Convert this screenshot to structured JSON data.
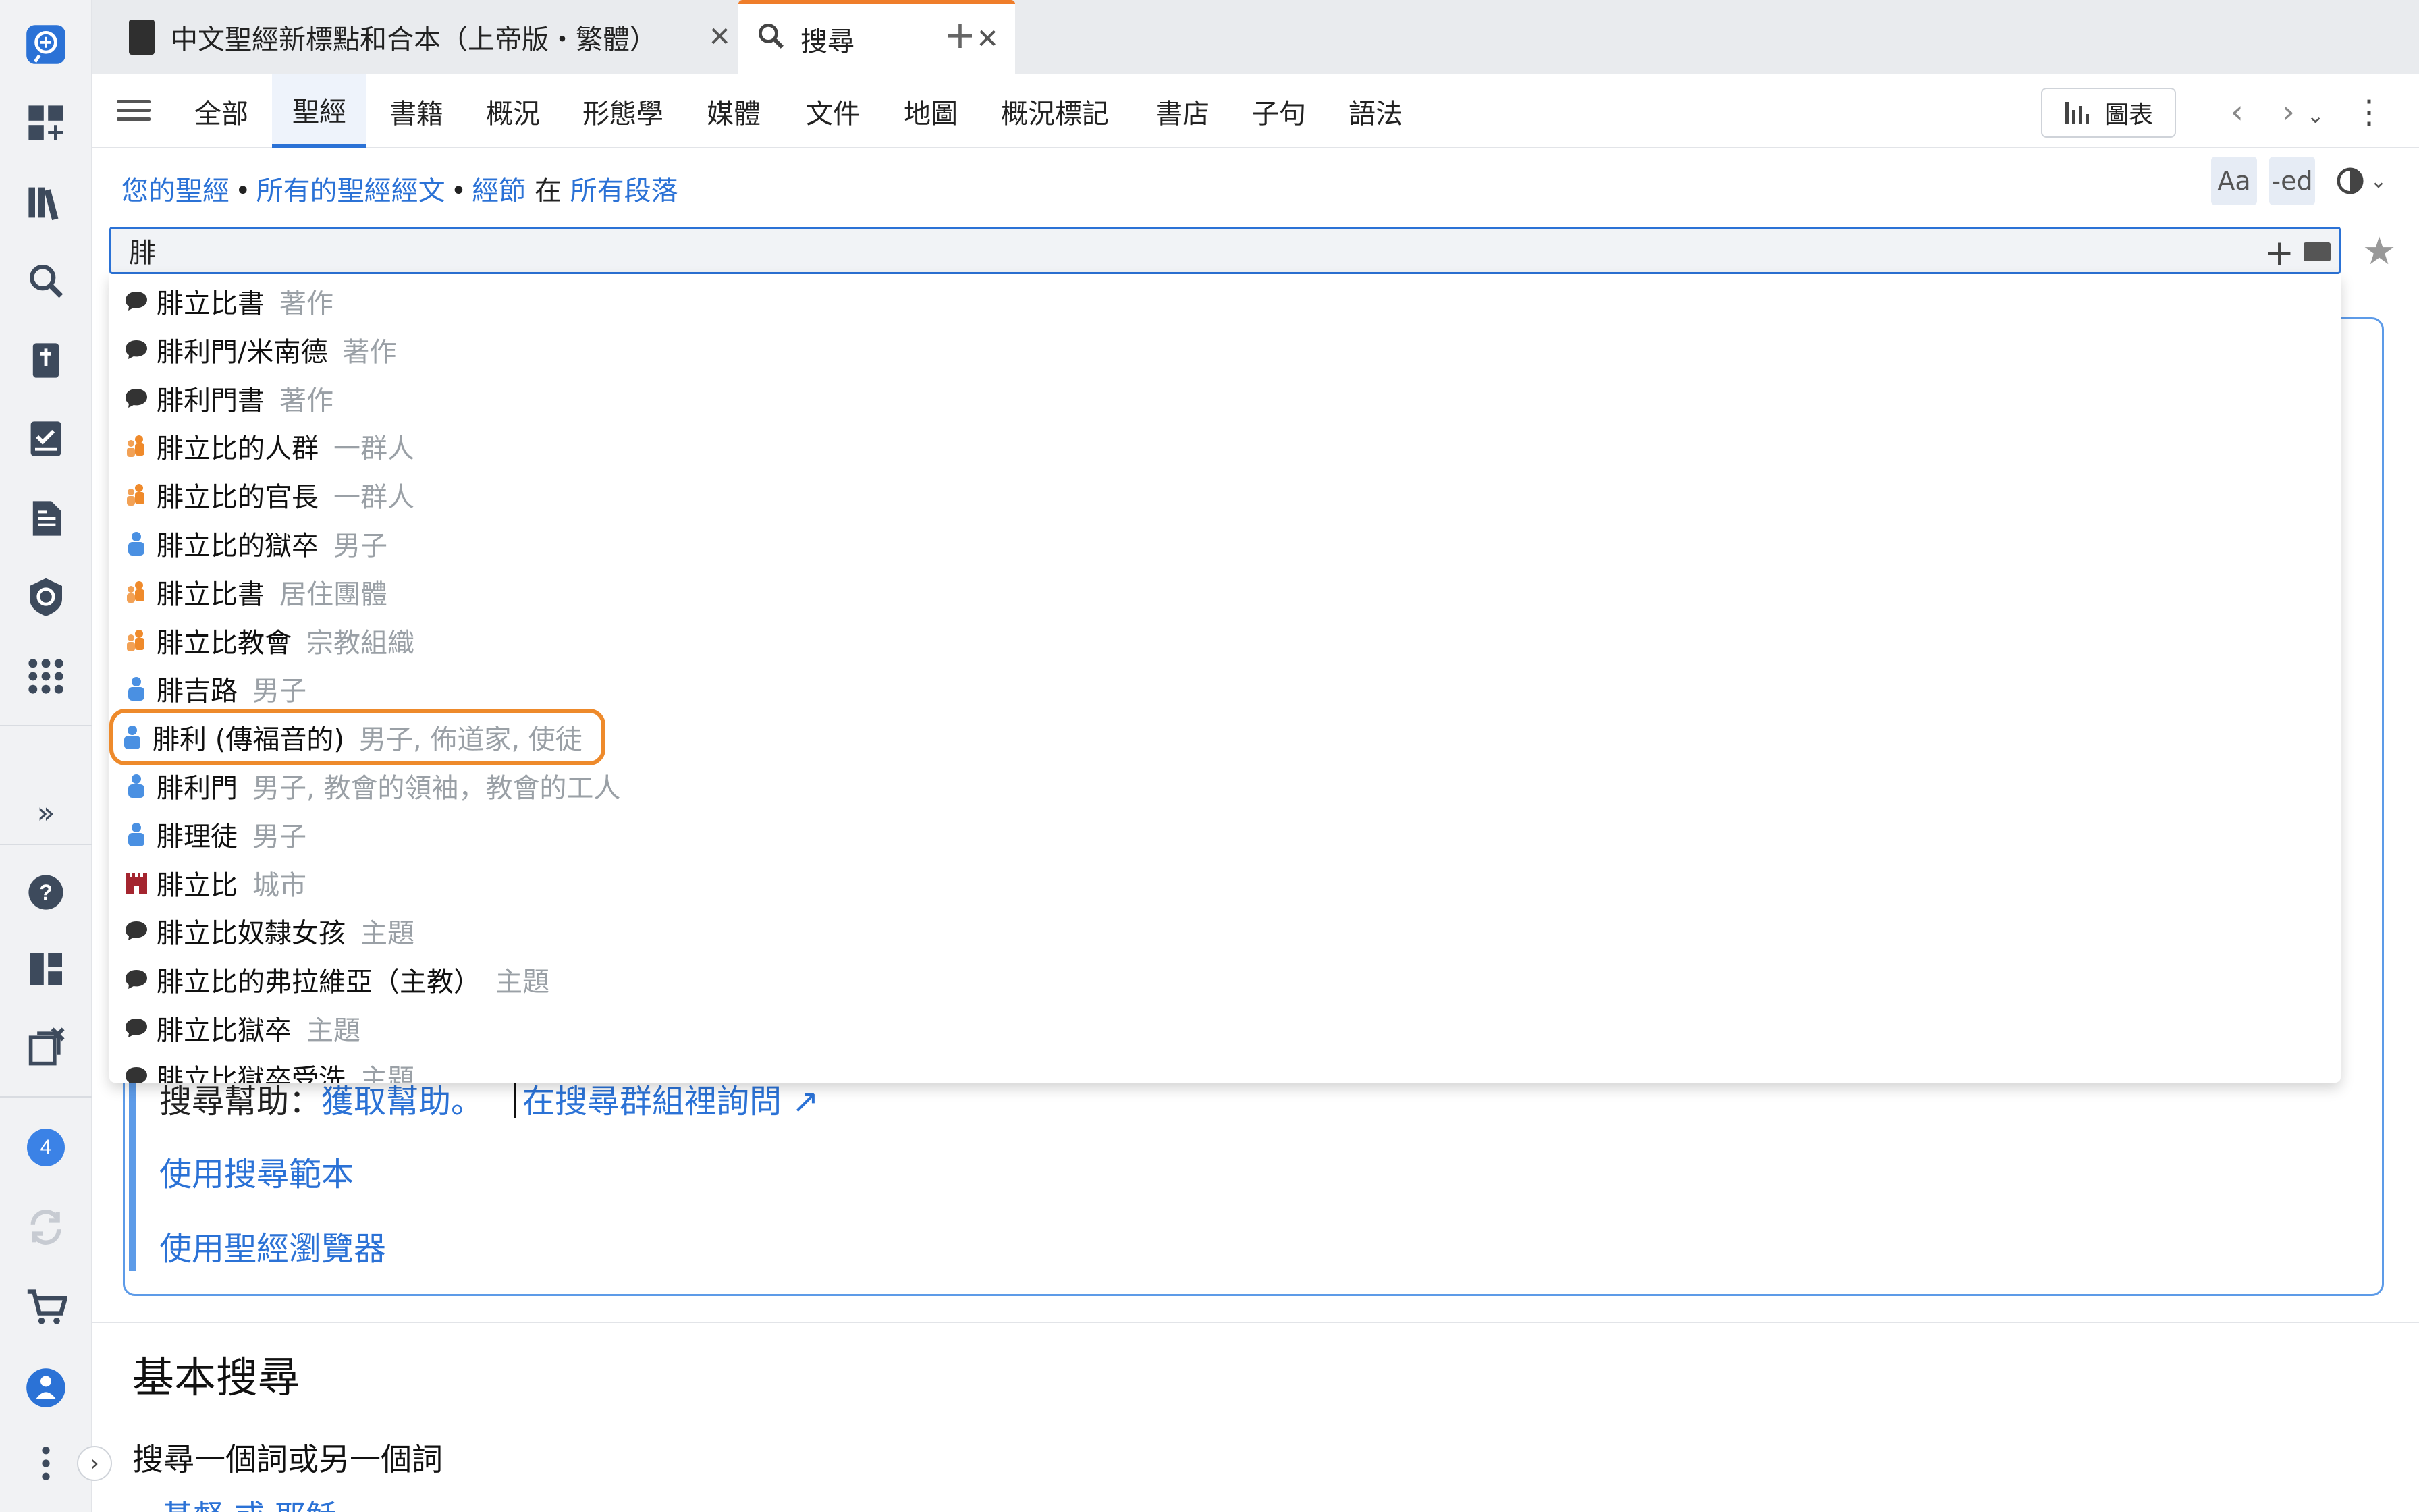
{
  "tabs": [
    {
      "label": "中文聖經新標點和合本（上帝版・繁體）",
      "icon": "book-icon",
      "close": "✕"
    },
    {
      "label": "搜尋",
      "icon": "search-icon",
      "close": "✕",
      "active": true
    }
  ],
  "tab_add": "+",
  "nav": {
    "items": [
      "全部",
      "聖經",
      "書籍",
      "概況",
      "形態學",
      "媒體",
      "文件",
      "地圖",
      "概況標記",
      "書店",
      "子句",
      "語法"
    ],
    "active_index": 1,
    "chart_label": "圖表"
  },
  "scope": {
    "your_bibles": "您的聖經",
    "all_text": "所有的聖經經文",
    "verses": "經節",
    "in": "在",
    "all_passages": "所有段落"
  },
  "topctl": {
    "font": "Aa",
    "ed": "-ed"
  },
  "search": {
    "value": "腓"
  },
  "suggestions": [
    {
      "name": "腓立比書",
      "kind": "著作",
      "icon": "speech-bubble-icon",
      "color": "#333333"
    },
    {
      "name": "腓利門/米南德",
      "kind": "著作",
      "icon": "speech-bubble-icon",
      "color": "#333333"
    },
    {
      "name": "腓利門書",
      "kind": "著作",
      "icon": "speech-bubble-icon",
      "color": "#333333"
    },
    {
      "name": "腓立比的人群",
      "kind": "一群人",
      "icon": "group-icon",
      "color": "#ef8a2b"
    },
    {
      "name": "腓立比的官長",
      "kind": "一群人",
      "icon": "group-icon",
      "color": "#ef8a2b"
    },
    {
      "name": "腓立比的獄卒",
      "kind": "男子",
      "icon": "person-icon",
      "color": "#4a90e2"
    },
    {
      "name": "腓立比書",
      "kind": "居住團體",
      "icon": "group-icon",
      "color": "#ef8a2b"
    },
    {
      "name": "腓立比教會",
      "kind": "宗教組織",
      "icon": "group-icon",
      "color": "#ef8a2b"
    },
    {
      "name": "腓吉路",
      "kind": "男子",
      "icon": "person-icon",
      "color": "#4a90e2"
    },
    {
      "name": "腓利 (傳福音的)",
      "kind": "男子, 佈道家, 使徒",
      "icon": "person-icon",
      "color": "#4a90e2",
      "highlight": true
    },
    {
      "name": "腓利門",
      "kind": "男子, 教會的領袖，教會的工人",
      "icon": "person-icon",
      "color": "#4a90e2"
    },
    {
      "name": "腓理徒",
      "kind": "男子",
      "icon": "person-icon",
      "color": "#4a90e2"
    },
    {
      "name": "腓立比",
      "kind": "城市",
      "icon": "castle-icon",
      "color": "#a4252f"
    },
    {
      "name": "腓立比奴隸女孩",
      "kind": "主題",
      "icon": "speech-bubble-icon",
      "color": "#333333"
    },
    {
      "name": "腓立比的弗拉維亞（主教）",
      "kind": "主題",
      "icon": "speech-bubble-icon",
      "color": "#333333"
    },
    {
      "name": "腓立比獄卒",
      "kind": "主題",
      "icon": "speech-bubble-icon",
      "color": "#333333"
    },
    {
      "name": "腓立比獄卒受洗",
      "kind": "主題",
      "icon": "speech-bubble-icon",
      "color": "#333333"
    }
  ],
  "help": {
    "label": "搜尋幫助：",
    "get_help": "獲取幫助。",
    "ask_group": "在搜尋群組裡詢問",
    "templates": "使用搜尋範本",
    "browser": "使用聖經瀏覽器"
  },
  "basic": {
    "title": "基本搜尋",
    "sub": "搜尋一個詞或另一個詞",
    "example": "基督 或 耶穌"
  },
  "rail_badge": "4",
  "colors": {
    "accent": "#2b72d6",
    "highlight": "#ee8a2b",
    "active_tab_border": "#ef7d2a"
  }
}
